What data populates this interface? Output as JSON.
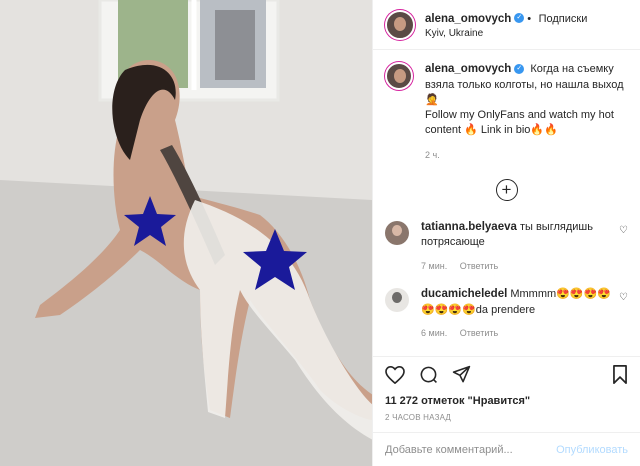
{
  "header": {
    "username": "alena_omovych",
    "dot": "•",
    "follow_label": "Подписки",
    "location": "Kyiv, Ukraine"
  },
  "caption": {
    "username": "alena_omovych",
    "text_line1": "Когда на съемку взяла только колготы, но нашла выход🤦",
    "text_line2": "Follow my OnlyFans and watch my hot content 🔥 Link in bio🔥🔥",
    "time": "2 ч."
  },
  "comments": [
    {
      "username": "tatianna.belyaeva",
      "text": "ты выглядишь потрясающе",
      "time": "7 мин.",
      "reply": "Ответить"
    },
    {
      "username": "ducamicheledel",
      "text": "Mmmmm😍😍😍😍😍😍😍😍da prendere",
      "time": "6 мин.",
      "reply": "Ответить"
    }
  ],
  "likes": "11 272 отметок \"Нравится\"",
  "posted_ago": "2 ЧАСОВ НАЗАД",
  "add_comment": {
    "placeholder": "Добавьте комментарий...",
    "publish_label": "Опубликовать"
  },
  "colors": {
    "verified": "#3897f0",
    "censor_star": "#1a1a9a",
    "publish_disabled": "#b3dbff",
    "meta_gray": "#8e8e8e"
  },
  "icons": [
    "heart-icon",
    "comment-icon",
    "share-icon",
    "bookmark-icon",
    "plus-circle-icon",
    "verified-icon"
  ]
}
